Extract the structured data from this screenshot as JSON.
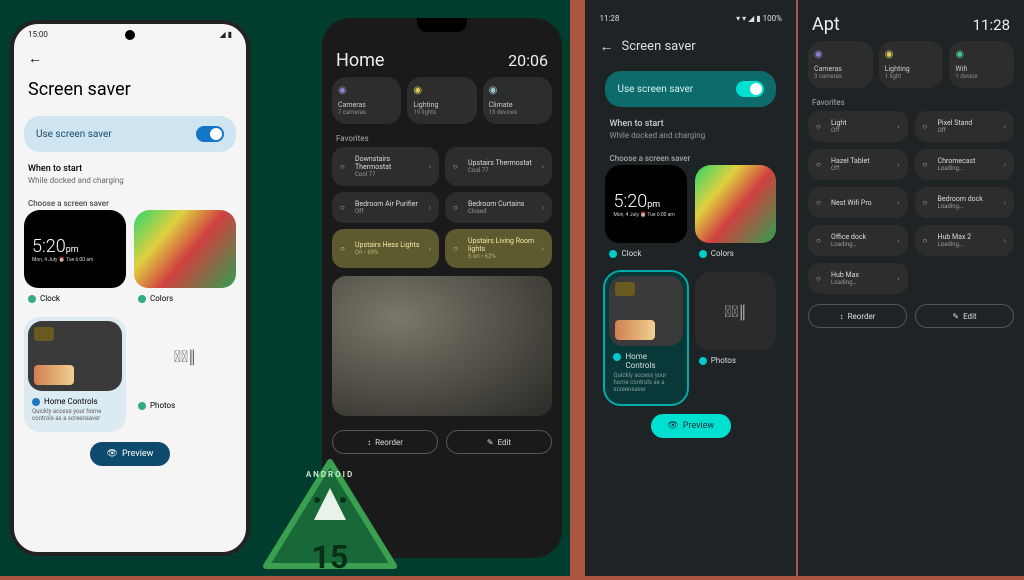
{
  "phone1": {
    "status_time": "15:00",
    "title": "Screen saver",
    "toggle_label": "Use screen saver",
    "when_label": "When to start",
    "when_sub": "While docked and charging",
    "choose_label": "Choose a screen saver",
    "clock_time": "5:20",
    "clock_ampm": "pm",
    "clock_date": "Mon, 4 July ⏰ Tue 6:00 am",
    "tile_clock": "Clock",
    "tile_colors": "Colors",
    "tile_home": "Home Controls",
    "tile_home_desc": "Quickly access your home controls as a screensaver",
    "tile_photos": "Photos",
    "preview": "Preview"
  },
  "phone2": {
    "title": "Home",
    "clock": "20:06",
    "cats": [
      {
        "name": "Cameras",
        "sub": "7 cameras",
        "c": "#88c"
      },
      {
        "name": "Lighting",
        "sub": "19 lights",
        "c": "#dc5"
      },
      {
        "name": "Climate",
        "sub": "13 devices",
        "c": "#9cc"
      }
    ],
    "fav": "Favorites",
    "devs": [
      {
        "name": "Downstairs Thermostat",
        "sub": "Cool 77",
        "lit": false
      },
      {
        "name": "Upstairs Thermostat",
        "sub": "Cool 77",
        "lit": false
      },
      {
        "name": "Bedroom Air Purifier",
        "sub": "Off",
        "lit": false
      },
      {
        "name": "Bedroom Curtains",
        "sub": "Closed",
        "lit": false
      },
      {
        "name": "Upstairs Hess Lights",
        "sub": "On • 69%",
        "lit": true
      },
      {
        "name": "Upstairs Living Room lights",
        "sub": "5 on • 62%",
        "lit": true
      }
    ],
    "reorder": "Reorder",
    "edit": "Edit"
  },
  "col1": {
    "status_time": "11:28",
    "status_right": "▾ ▾ ◢ ▮ 100%",
    "title": "Screen saver",
    "toggle_label": "Use screen saver",
    "when_label": "When to start",
    "when_sub": "While docked and charging",
    "choose_label": "Choose a screen saver",
    "clock_time": "5:20",
    "clock_ampm": "pm",
    "clock_date": "Mon, 4 July ⏰ Tue 6:00 am",
    "tile_clock": "Clock",
    "tile_colors": "Colors",
    "tile_home": "Home Controls",
    "tile_home_desc": "Quickly access your home controls as a screensaver",
    "tile_photos": "Photos",
    "preview": "Preview"
  },
  "col2": {
    "title": "Apt",
    "clock": "11:28",
    "cats": [
      {
        "name": "Cameras",
        "sub": "3 cameras",
        "c": "#88c"
      },
      {
        "name": "Lighting",
        "sub": "1 light",
        "c": "#dc5"
      },
      {
        "name": "Wifi",
        "sub": "1 device",
        "c": "#4c8"
      }
    ],
    "fav": "Favorites",
    "devs": [
      {
        "name": "Light",
        "sub": "Off"
      },
      {
        "name": "Pixel Stand",
        "sub": "Off"
      },
      {
        "name": "Hazel Tablet",
        "sub": "Off"
      },
      {
        "name": "Chromecast",
        "sub": "Loading…"
      },
      {
        "name": "Nest Wifi Pro",
        "sub": ""
      },
      {
        "name": "Bedroom dock",
        "sub": "Loading…"
      },
      {
        "name": "Office dock",
        "sub": "Loading…"
      },
      {
        "name": "Hub Max 2",
        "sub": "Loading…"
      },
      {
        "name": "Hub Max",
        "sub": "Loading…"
      }
    ],
    "reorder": "Reorder",
    "edit": "Edit"
  },
  "badge": {
    "brand": "ANDROID",
    "version": "15"
  }
}
